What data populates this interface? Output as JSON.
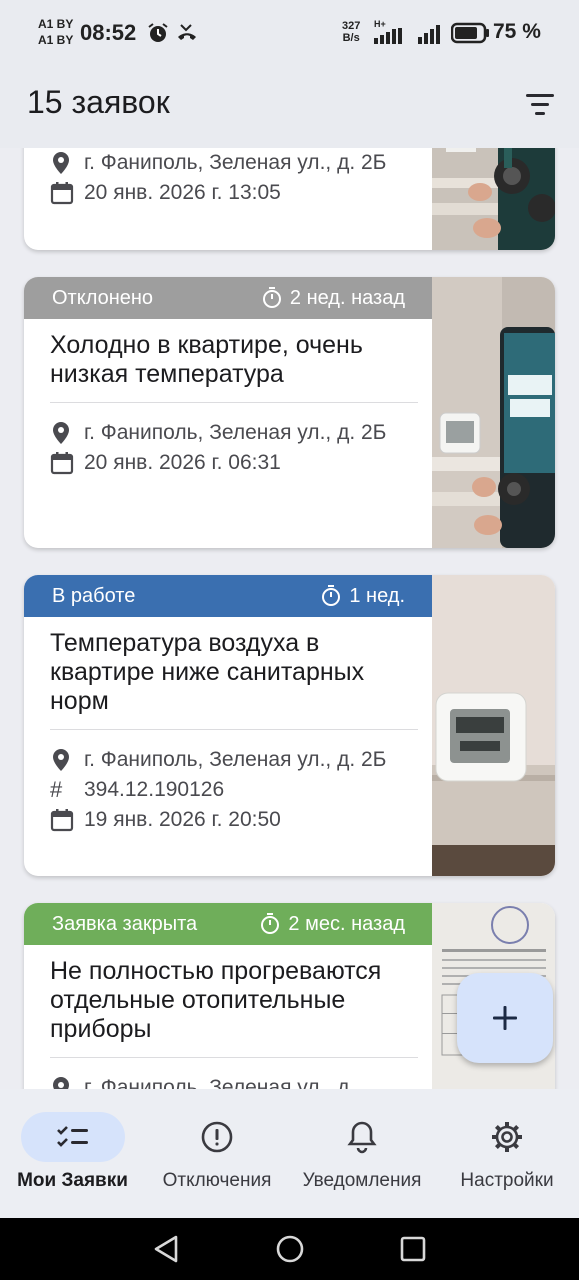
{
  "status_bar": {
    "carrier_1": "A1 BY",
    "carrier_2": "A1 BY",
    "time": "08:52",
    "net_speed_value": "327",
    "net_speed_unit": "B/s",
    "network_type": "H+",
    "battery": "75 %"
  },
  "app_bar": {
    "title": "15 заявок",
    "filter_icon": "filter-icon"
  },
  "cards": [
    {
      "address": "г. Фаниполь, Зеленая ул., д. 2Б",
      "date": "20 янв. 2026 г. 13:05"
    },
    {
      "status": "Отклонено",
      "status_color": "#9e9e9e",
      "duration": "2 нед. назад",
      "title": "Холодно в квартире, очень низкая температура",
      "address": "г. Фаниполь, Зеленая ул., д. 2Б",
      "date": "20 янв. 2026 г. 06:31"
    },
    {
      "status": "В работе",
      "status_color": "#3a6fb0",
      "duration": "1 нед.",
      "title": "Температура воздуха в квартире ниже санитарных норм",
      "address": "г. Фаниполь, Зеленая ул., д. 2Б",
      "number": "394.12.190126",
      "date": "19 янв. 2026 г. 20:50"
    },
    {
      "status": "Заявка закрыта",
      "status_color": "#6fae5a",
      "duration": "2 мес. назад",
      "title": "Не полностью прогреваются отдельные отопительные приборы",
      "address": "г. Фаниполь, Зеленая ул., д."
    }
  ],
  "fab": {
    "icon": "add-icon",
    "color": "#d6e3fb"
  },
  "bottom_nav": [
    {
      "label": "Мои Заявки",
      "icon": "checklist-icon",
      "active": true
    },
    {
      "label": "Отключения",
      "icon": "alert-circle-icon",
      "active": false
    },
    {
      "label": "Уведомления",
      "icon": "bell-icon",
      "active": false
    },
    {
      "label": "Настройки",
      "icon": "gear-icon",
      "active": false
    }
  ],
  "system_nav": [
    "back-icon",
    "home-icon",
    "recents-icon"
  ]
}
